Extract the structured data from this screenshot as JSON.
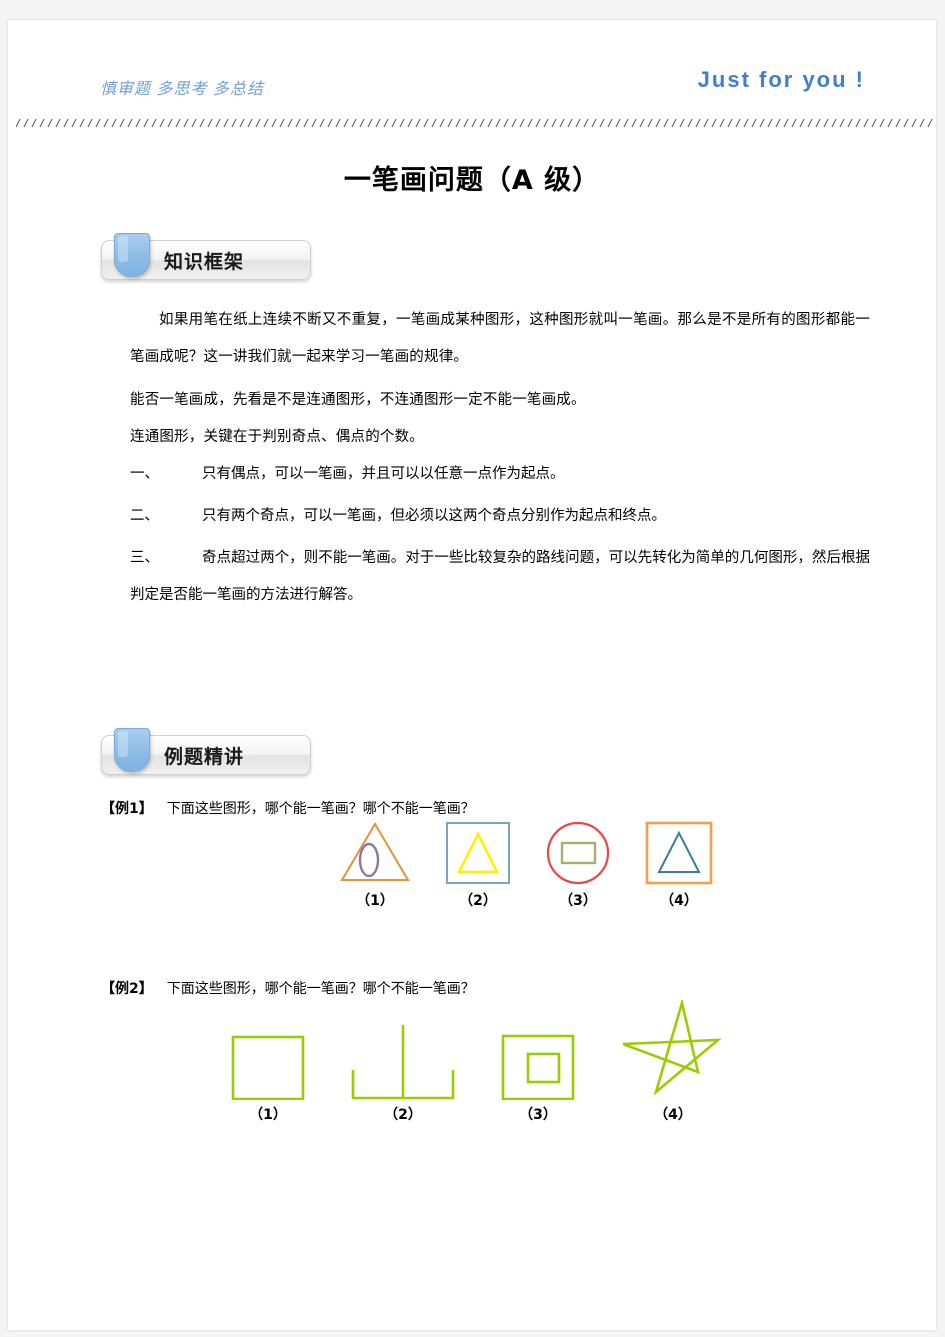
{
  "header": {
    "slogan": "慎审题 多思考 多总结",
    "tagline": "Just for you !",
    "slogan_color": "#6f9fd8",
    "tagline_color": "#3f7fd0"
  },
  "title": "一笔画问题（A 级）",
  "sections": [
    {
      "id": "knowledge",
      "label": "知识框架"
    },
    {
      "id": "examples",
      "label": "例题精讲"
    }
  ],
  "knowledge": {
    "intro": "如果用笔在纸上连续不断又不重复，一笔画成某种图形，这种图形就叫一笔画。那么是不是所有的图形都能一笔画成呢？这一讲我们就一起来学习一笔画的规律。",
    "line1": "能否一笔画成，先看是不是连通图形，不连通图形一定不能一笔画成。",
    "line2": "连通图形，关键在于判别奇点、偶点的个数。",
    "rules": [
      {
        "num": "一、",
        "text": "只有偶点，可以一笔画，并且可以以任意一点作为起点。"
      },
      {
        "num": "二、",
        "text": "只有两个奇点，可以一笔画，但必须以这两个奇点分别作为起点和终点。"
      },
      {
        "num": "三、",
        "text": "奇点超过两个，则不能一笔画。对于一些比较复杂的路线问题，可以先转化为简单的几何图形，然后根据判定是否能一笔画的方法进行解答。"
      }
    ]
  },
  "examples": [
    {
      "tag": "【例1】",
      "prompt": "下面这些图形，哪个能一笔画？哪个不能一笔画？",
      "figures": [
        {
          "label": "（1）",
          "shape": "triangle-with-ellipse",
          "outer_color": "#E8913A",
          "inner_color": "#8878A8"
        },
        {
          "label": "（2）",
          "shape": "square-with-triangle",
          "outer_color": "#7BA7BC",
          "inner_color": "#FFF000"
        },
        {
          "label": "（3）",
          "shape": "circle-with-rectangle",
          "outer_color": "#EE4444",
          "inner_color": "#A3B06E"
        },
        {
          "label": "（4）",
          "shape": "square-with-triangle",
          "outer_color": "#F0A050",
          "inner_color": "#3A7D9E"
        }
      ]
    },
    {
      "tag": "【例2】",
      "prompt": "下面这些图形，哪个能一笔画？哪个不能一笔画？",
      "figures": [
        {
          "label": "（1）",
          "shape": "square",
          "outer_color": "#9ACD00",
          "inner_color": ""
        },
        {
          "label": "（2）",
          "shape": "shan-shape",
          "outer_color": "#9ACD00",
          "inner_color": ""
        },
        {
          "label": "（3）",
          "shape": "square-in-square",
          "outer_color": "#9ACD00",
          "inner_color": "#9ACD00"
        },
        {
          "label": "（4）",
          "shape": "five-point-star",
          "outer_color": "#9ACD00",
          "inner_color": ""
        }
      ]
    }
  ]
}
